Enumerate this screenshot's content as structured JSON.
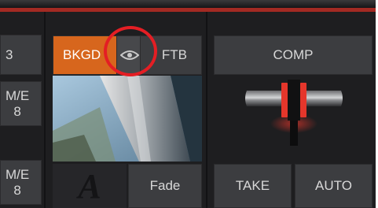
{
  "left_column": {
    "row1_label": "3",
    "row2_label": "M/E\n8",
    "row3_label": "M/E\n8"
  },
  "transition": {
    "bkgd_label": "BKGD",
    "ftb_label": "FTB",
    "comp_label": "COMP",
    "fade_label": "Fade",
    "take_label": "TAKE",
    "auto_label": "AUTO",
    "logo_letter": "A"
  },
  "icons": {
    "eye": "eye-icon",
    "tbar": "tbar-handle-icon"
  },
  "colors": {
    "accent_orange": "#d7661d",
    "highlight_red": "#e41e24",
    "tbar_red": "#e5362b"
  }
}
